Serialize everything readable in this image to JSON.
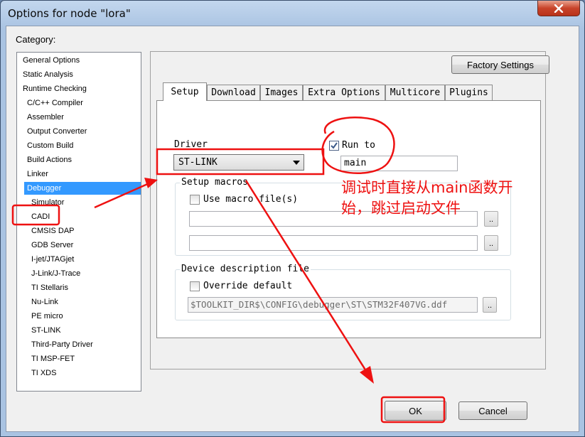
{
  "window": {
    "title": "Options for node \"lora\""
  },
  "category": {
    "label": "Category:",
    "items": [
      {
        "label": "General Options"
      },
      {
        "label": "Static Analysis"
      },
      {
        "label": "Runtime Checking"
      },
      {
        "label": "C/C++ Compiler"
      },
      {
        "label": "Assembler"
      },
      {
        "label": "Output Converter"
      },
      {
        "label": "Custom Build"
      },
      {
        "label": "Build Actions"
      },
      {
        "label": "Linker"
      },
      {
        "label": "Debugger"
      },
      {
        "label": "Simulator"
      },
      {
        "label": "CADI"
      },
      {
        "label": "CMSIS DAP"
      },
      {
        "label": "GDB Server"
      },
      {
        "label": "I-jet/JTAGjet"
      },
      {
        "label": "J-Link/J-Trace"
      },
      {
        "label": "TI Stellaris"
      },
      {
        "label": "Nu-Link"
      },
      {
        "label": "PE micro"
      },
      {
        "label": "ST-LINK"
      },
      {
        "label": "Third-Party Driver"
      },
      {
        "label": "TI MSP-FET"
      },
      {
        "label": "TI XDS"
      }
    ],
    "selected": "Debugger"
  },
  "factory_settings_label": "Factory Settings",
  "tabs": [
    "Setup",
    "Download",
    "Images",
    "Extra Options",
    "Multicore",
    "Plugins"
  ],
  "setup": {
    "driver_label": "Driver",
    "driver_value": "ST-LINK",
    "run_to_label": "Run to",
    "run_to_checked": true,
    "run_to_value": "main",
    "setup_macros_label": "Setup macros",
    "use_macro_label": "Use macro file(s)",
    "use_macro_checked": false,
    "macro_file_1": "",
    "macro_file_2": "",
    "device_desc_label": "Device description file",
    "override_label": "Override default",
    "override_checked": false,
    "ddf_path": "$TOOLKIT_DIR$\\CONFIG\\debugger\\ST\\STM32F407VG.ddf",
    "browse_label": ".."
  },
  "buttons": {
    "ok": "OK",
    "cancel": "Cancel"
  },
  "annotation": {
    "line1": "调试时直接从main函数开",
    "line2": "始，跳过启动文件"
  },
  "colors": {
    "highlight": "#3399ff",
    "annotation": "#ee1111"
  }
}
